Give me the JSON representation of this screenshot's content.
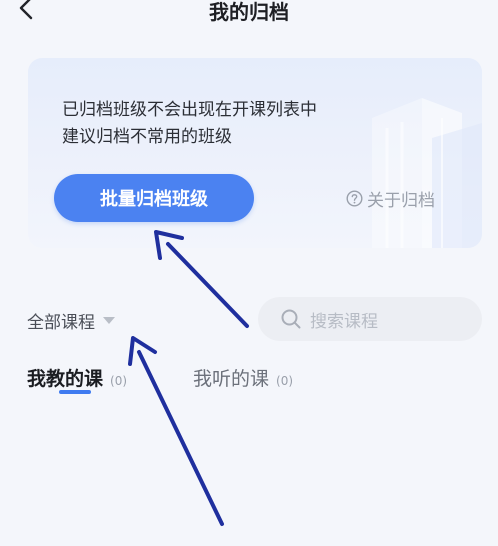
{
  "header": {
    "title": "我的归档",
    "back_icon": "chevron-left-icon"
  },
  "info_card": {
    "line1": "已归档班级不会出现在开课列表中",
    "line2": "建议归档不常用的班级",
    "batch_button_label": "批量归档班级",
    "about_label": "关于归档",
    "about_icon": "question-circle-icon"
  },
  "filter": {
    "course_filter_label": "全部课程",
    "caret_icon": "caret-down-icon",
    "search_placeholder": "搜索课程",
    "search_icon": "search-icon"
  },
  "tabs": [
    {
      "label": "我教的课",
      "count": "(0)",
      "active": true
    },
    {
      "label": "我听的课",
      "count": "(0)",
      "active": false
    }
  ],
  "colors": {
    "accent": "#4b82f1",
    "tab_indicator": "#3f7bf0",
    "annotation_arrow": "#1f2f9e",
    "background": "#f4f6fb"
  }
}
